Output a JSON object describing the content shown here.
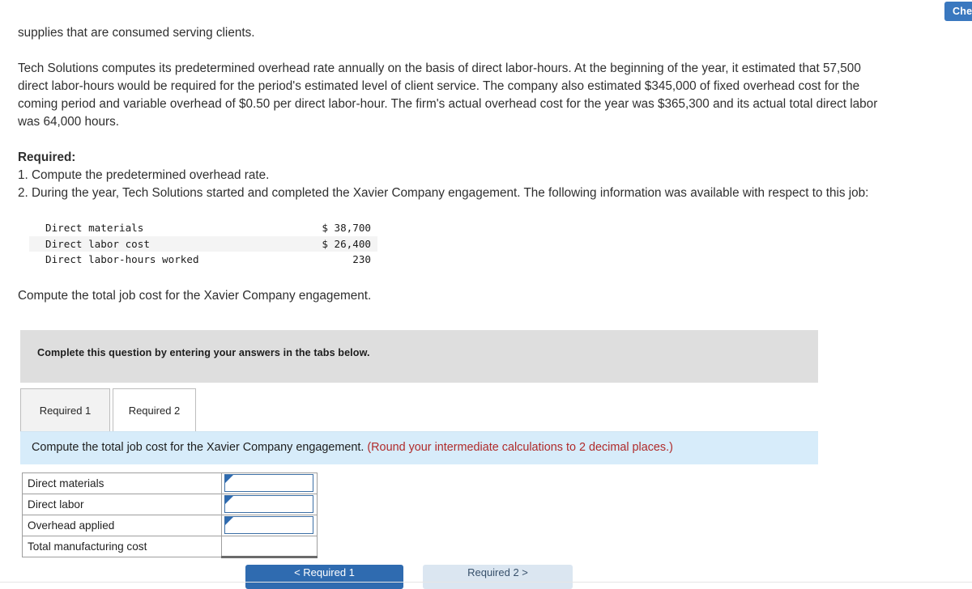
{
  "toolbar": {
    "check_work_label": "Check my work"
  },
  "question": {
    "intro_fragment": "supplies that are consumed serving clients.",
    "scenario": "Tech Solutions computes its predetermined overhead rate annually on the basis of direct labor-hours. At the beginning of the year, it estimated that 57,500 direct labor-hours would be required for the period's estimated level of client service. The company also estimated $345,000 of fixed overhead cost for the coming period and variable overhead of $0.50 per direct labor-hour. The firm's actual overhead cost for the year was $365,300 and its actual total direct labor was 64,000 hours.",
    "required_label": "Required:",
    "requirement_1": "1. Compute the predetermined overhead rate.",
    "requirement_2": "2. During the year, Tech Solutions started and completed the Xavier Company engagement. The following information was available with respect to this job:",
    "closing": "Compute the total job cost for the Xavier Company engagement."
  },
  "job_data_table": {
    "rows": [
      {
        "label": "Direct materials",
        "value": "$ 38,700"
      },
      {
        "label": "Direct labor cost",
        "value": "$ 26,400"
      },
      {
        "label": "Direct labor-hours worked",
        "value": "230"
      }
    ]
  },
  "complete_banner": {
    "text": "Complete this question by entering your answers in the tabs below."
  },
  "tabs": [
    {
      "label": "Required 1",
      "active": false
    },
    {
      "label": "Required 2",
      "active": true
    }
  ],
  "instruction": {
    "main": "Compute the total job cost for the Xavier Company engagement.",
    "hint": "(Round your intermediate calculations to 2 decimal places.)"
  },
  "answer_table": {
    "rows": [
      {
        "label": "Direct materials",
        "value": "",
        "has_input": true
      },
      {
        "label": "Direct labor",
        "value": "",
        "has_input": true
      },
      {
        "label": "Overhead applied",
        "value": "",
        "has_input": true
      },
      {
        "label": "Total manufacturing cost",
        "value": "",
        "has_input": false
      }
    ]
  },
  "nav": {
    "prev_label": "< Required 1",
    "next_label": "Required 2 >"
  },
  "colors": {
    "accent_blue": "#2f6bb0",
    "instruction_bg": "#d7ecfa",
    "banner_gray": "#dedede",
    "hint_red": "#b02b2b"
  }
}
